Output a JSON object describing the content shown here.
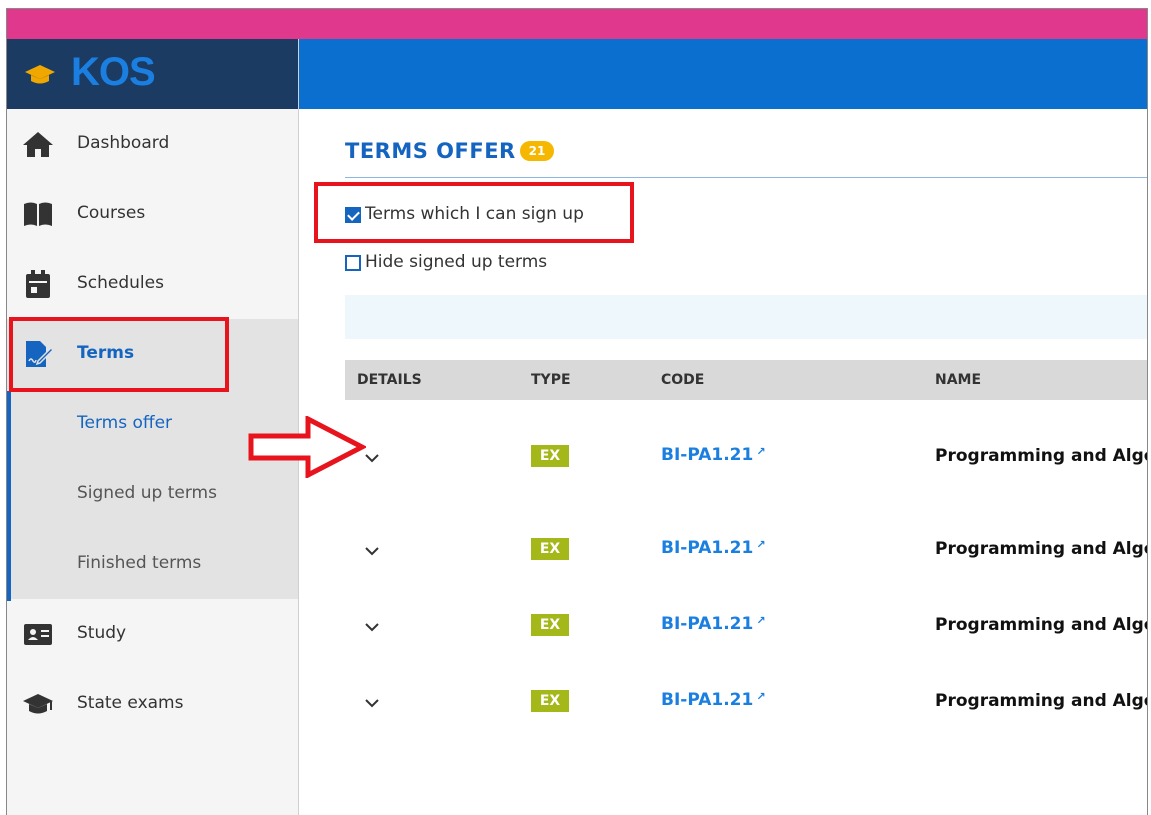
{
  "app": {
    "logo_text": "KOS"
  },
  "sidebar": {
    "items": [
      {
        "label": "Dashboard",
        "icon": "home-icon"
      },
      {
        "label": "Courses",
        "icon": "book-icon"
      },
      {
        "label": "Schedules",
        "icon": "calendar-icon"
      },
      {
        "label": "Terms",
        "icon": "edit-document-icon"
      },
      {
        "label": "Study",
        "icon": "id-card-icon"
      },
      {
        "label": "State exams",
        "icon": "graduation-cap-icon"
      }
    ],
    "sub_items": [
      "Terms offer",
      "Signed up terms",
      "Finished terms"
    ]
  },
  "main": {
    "title": "TERMS OFFER",
    "count_badge": "21",
    "filters": [
      {
        "label": "Terms which I can sign up",
        "checked": true
      },
      {
        "label": "Hide signed up terms",
        "checked": false
      }
    ],
    "table": {
      "headers": [
        "DETAILS",
        "TYPE",
        "CODE",
        "NAME"
      ],
      "rows": [
        {
          "type": "EX",
          "code": "BI-PA1.21",
          "name": "Programming and Algo"
        },
        {
          "type": "EX",
          "code": "BI-PA1.21",
          "name": "Programming and Algo"
        },
        {
          "type": "EX",
          "code": "BI-PA1.21",
          "name": "Programming and Algo"
        },
        {
          "type": "EX",
          "code": "BI-PA1.21",
          "name": "Programming and Algo"
        }
      ]
    }
  },
  "colors": {
    "topbar": "#e0388d",
    "header": "#0a6fcf",
    "logo_bg": "#1b3b63",
    "accent": "#1565c0",
    "badge": "#f5b700",
    "type_badge": "#a5b81a",
    "highlight": "#e8141d"
  }
}
